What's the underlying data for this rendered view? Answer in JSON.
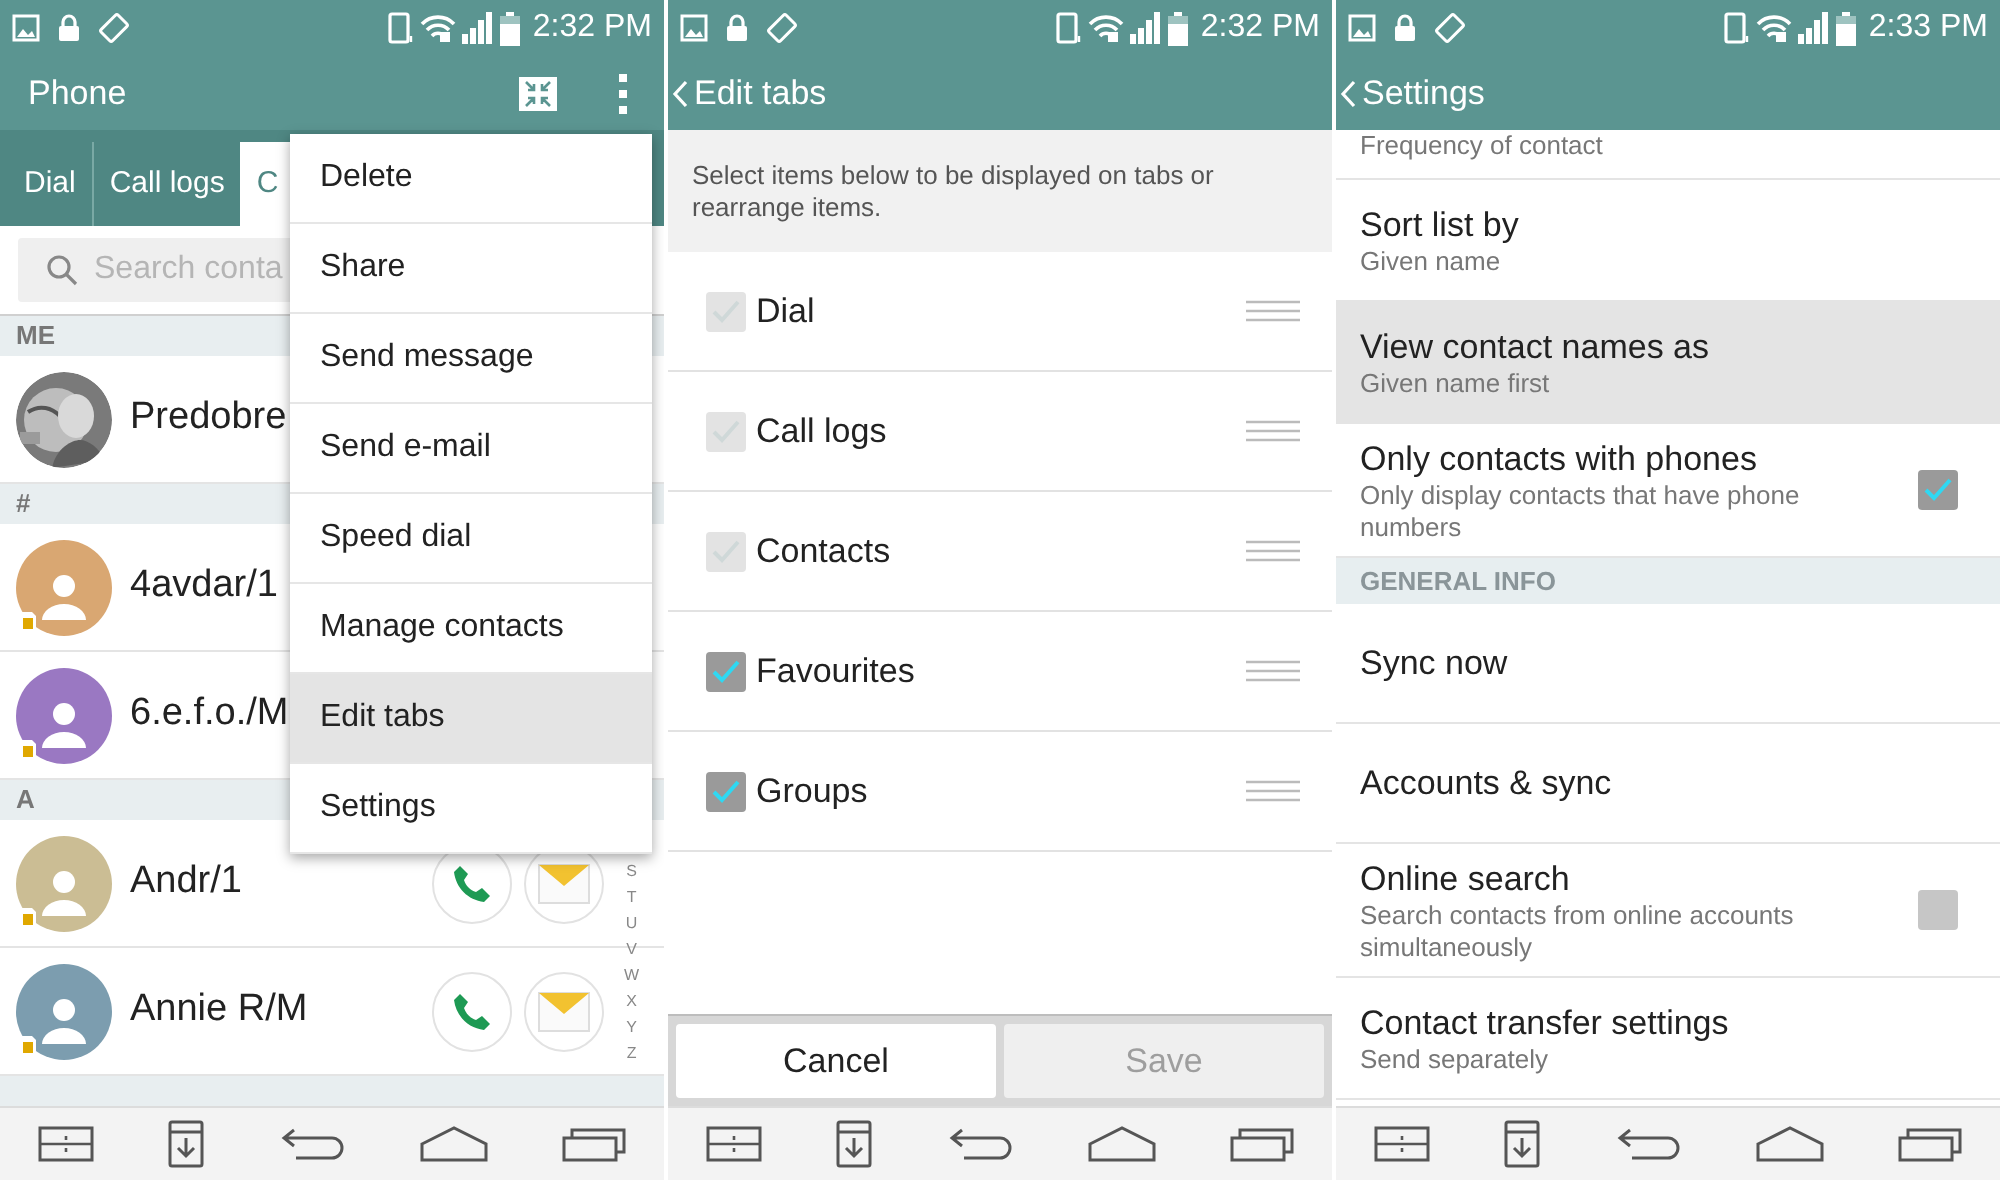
{
  "screens": [
    {
      "kind": "contacts",
      "status_bar": {
        "time": "2:32 PM"
      },
      "app_bar": {
        "title": "Phone"
      },
      "tabs": [
        {
          "label": "Dial",
          "selected": false
        },
        {
          "label": "Call logs",
          "selected": false
        },
        {
          "label": "C",
          "selected": true
        }
      ],
      "search": {
        "placeholder": "Search conta"
      },
      "sections": [
        {
          "header": "ME",
          "contacts": [
            {
              "name": "Predobre"
            }
          ]
        },
        {
          "header": "#",
          "contacts": [
            {
              "name": "4avdar/1",
              "kind": "default",
              "color": "#d9a772"
            },
            {
              "name": "6.e.f.o./M",
              "kind": "default",
              "color": "#9a78c2"
            }
          ]
        },
        {
          "header": "A",
          "contacts": [
            {
              "name": "Andr/1",
              "kind": "default",
              "color": "#cbbd94",
              "actions": true
            },
            {
              "name": "Annie R/M",
              "kind": "default",
              "color": "#7c9daf",
              "actions": true
            }
          ]
        }
      ],
      "index_letters": [
        "S",
        "T",
        "U",
        "V",
        "W",
        "X",
        "Y",
        "Z"
      ],
      "menu": [
        {
          "label": "Delete",
          "selected": false
        },
        {
          "label": "Share",
          "selected": false
        },
        {
          "label": "Send message",
          "selected": false
        },
        {
          "label": "Send e-mail",
          "selected": false
        },
        {
          "label": "Speed dial",
          "selected": false
        },
        {
          "label": "Manage contacts",
          "selected": false
        },
        {
          "label": "Edit tabs",
          "selected": true
        },
        {
          "label": "Settings",
          "selected": false
        }
      ]
    },
    {
      "kind": "edit_tabs",
      "status_bar": {
        "time": "2:32 PM"
      },
      "app_bar": {
        "title": "Edit tabs"
      },
      "description": "Select items below to be displayed on tabs or rearrange items.",
      "items": [
        {
          "label": "Dial",
          "checked": true,
          "disabled": true
        },
        {
          "label": "Call logs",
          "checked": true,
          "disabled": true
        },
        {
          "label": "Contacts",
          "checked": true,
          "disabled": true
        },
        {
          "label": "Favourites",
          "checked": true,
          "disabled": false
        },
        {
          "label": "Groups",
          "checked": true,
          "disabled": false
        }
      ],
      "buttons": [
        {
          "label": "Cancel",
          "disabled": false
        },
        {
          "label": "Save",
          "disabled": true
        }
      ]
    },
    {
      "kind": "settings",
      "status_bar": {
        "time": "2:33 PM"
      },
      "app_bar": {
        "title": "Settings"
      },
      "items": [
        {
          "kind": "item",
          "summary": "Frequency of contact",
          "selected": false
        },
        {
          "kind": "item",
          "title": "Sort list by",
          "summary": "Given name",
          "selected": false
        },
        {
          "kind": "item",
          "title": "View contact names as",
          "summary": "Given name first",
          "selected": true
        },
        {
          "kind": "checkbox",
          "title": "Only contacts with phones",
          "summary": "Only display contacts that have phone numbers",
          "checked": true
        },
        {
          "kind": "header",
          "title": "GENERAL INFO"
        },
        {
          "kind": "item",
          "title": "Sync now",
          "selected": false
        },
        {
          "kind": "item",
          "title": "Accounts & sync",
          "selected": false
        },
        {
          "kind": "checkbox",
          "title": "Online search",
          "summary": "Search contacts from online accounts simultaneously",
          "checked": false
        },
        {
          "kind": "item",
          "title": "Contact transfer settings",
          "summary": "Send separately",
          "selected": false
        }
      ]
    }
  ]
}
